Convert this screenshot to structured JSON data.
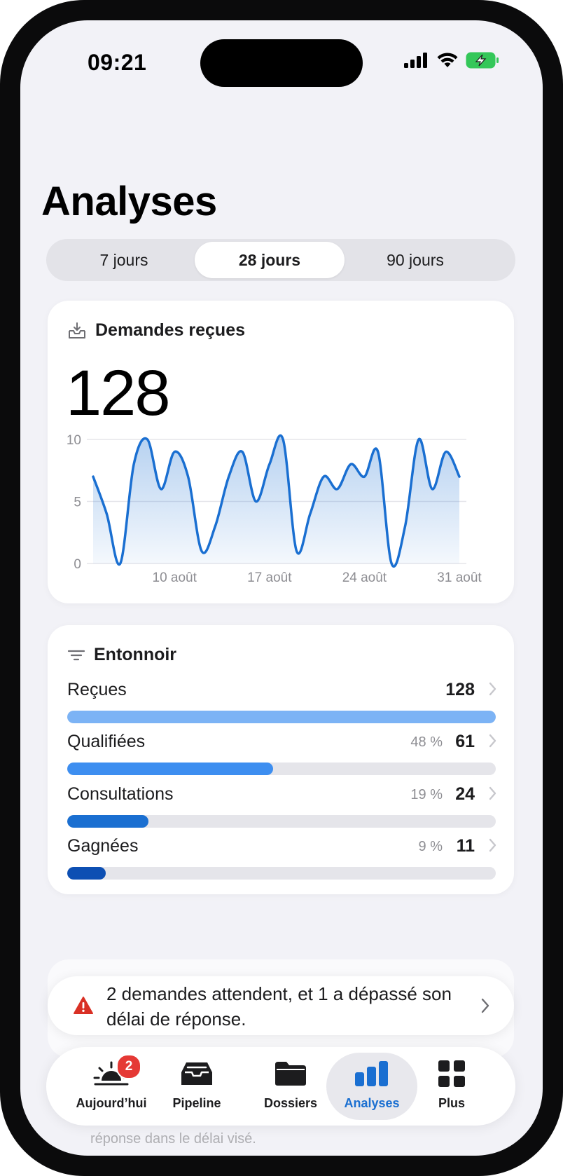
{
  "status_bar": {
    "time": "09:21"
  },
  "page": {
    "title": "Analyses"
  },
  "segments": [
    {
      "label": "7 jours",
      "active": false
    },
    {
      "label": "28 jours",
      "active": true
    },
    {
      "label": "90 jours",
      "active": false
    }
  ],
  "requests_card": {
    "title": "Demandes reçues",
    "icon": "inbox-icon",
    "total": "128"
  },
  "chart_data": {
    "type": "area",
    "x": [
      "4 août",
      "5 août",
      "6 août",
      "7 août",
      "8 août",
      "9 août",
      "10 août",
      "11 août",
      "12 août",
      "13 août",
      "14 août",
      "15 août",
      "16 août",
      "17 août",
      "18 août",
      "19 août",
      "20 août",
      "21 août",
      "22 août",
      "23 août",
      "24 août",
      "25 août",
      "26 août",
      "27 août",
      "28 août",
      "29 août",
      "30 août",
      "31 août"
    ],
    "values": [
      7,
      4,
      0,
      8,
      10,
      6,
      9,
      7,
      1,
      3,
      7,
      9,
      5,
      8,
      10,
      1,
      4,
      7,
      6,
      8,
      7,
      9,
      0,
      3,
      10,
      6,
      9,
      7
    ],
    "x_tick_labels": [
      "10 août",
      "17 août",
      "24 août",
      "31 août"
    ],
    "y_ticks": [
      0,
      5,
      10
    ],
    "ylim": [
      0,
      10
    ],
    "grid": true,
    "color": "#1a6fd1"
  },
  "funnel_card": {
    "title": "Entonnoir",
    "icon": "filter-lines-icon",
    "rows": [
      {
        "label": "Reçues",
        "percent": "",
        "value": "128",
        "fraction": 1.0,
        "color": "#7cb3f5"
      },
      {
        "label": "Qualifiées",
        "percent": "48 %",
        "value": "61",
        "fraction": 0.48,
        "color": "#3d8ef0"
      },
      {
        "label": "Consultations",
        "percent": "19 %",
        "value": "24",
        "fraction": 0.19,
        "color": "#1a6fd1"
      },
      {
        "label": "Gagnées",
        "percent": "9 %",
        "value": "11",
        "fraction": 0.09,
        "color": "#0d4fb3"
      }
    ]
  },
  "toast": {
    "icon": "warning-icon",
    "text": "2 demandes attendent, et 1 a dépassé son délai de réponse."
  },
  "background_text": "réponse dans le délai visé.",
  "tabbar": {
    "items": [
      {
        "label": "Aujourd’hui",
        "icon": "sunrise-icon",
        "badge": "2",
        "active": false
      },
      {
        "label": "Pipeline",
        "icon": "tray-icon",
        "active": false
      },
      {
        "label": "Dossiers",
        "icon": "folder-icon",
        "active": false
      },
      {
        "label": "Analyses",
        "icon": "bar-chart-icon",
        "active": true
      },
      {
        "label": "Plus",
        "icon": "grid-icon",
        "active": false
      }
    ]
  }
}
